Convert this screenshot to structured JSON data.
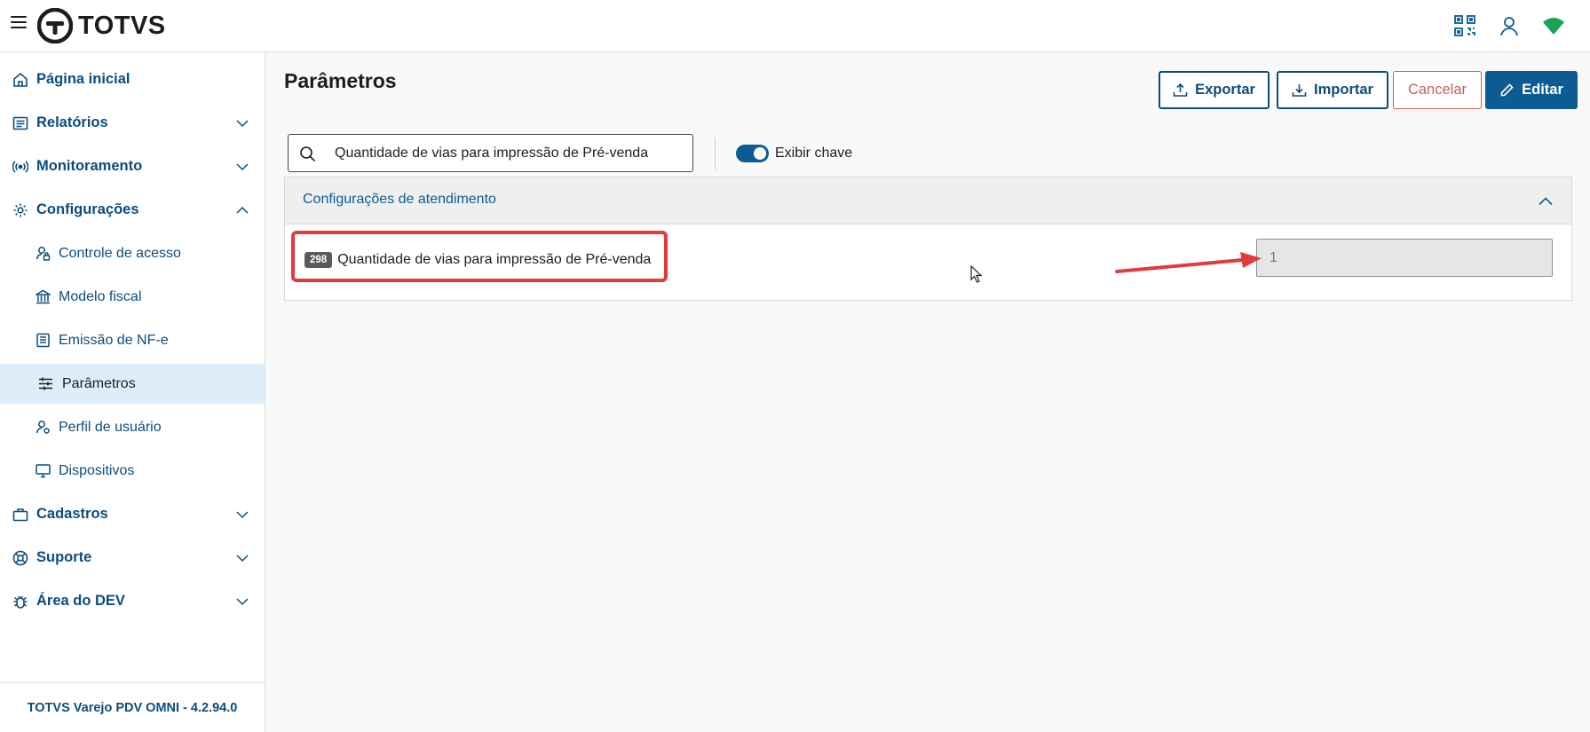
{
  "header": {
    "logo_text": "TOTVS",
    "icons": [
      "menu-icon",
      "qr-code-icon",
      "user-icon",
      "wifi-icon"
    ],
    "wifi_color": "#1ca35a"
  },
  "sidebar": {
    "items": [
      {
        "label": "Página inicial",
        "icon": "home-icon"
      },
      {
        "label": "Relatórios",
        "icon": "report-icon",
        "expanded": false
      },
      {
        "label": "Monitoramento",
        "icon": "broadcast-icon",
        "expanded": false
      },
      {
        "label": "Configurações",
        "icon": "gear-icon",
        "expanded": true
      },
      {
        "label": "Cadastros",
        "icon": "briefcase-icon",
        "expanded": false
      },
      {
        "label": "Suporte",
        "icon": "lifebuoy-icon",
        "expanded": false
      },
      {
        "label": "Área do DEV",
        "icon": "bug-icon",
        "expanded": false
      }
    ],
    "sub_items": [
      {
        "label": "Controle de acesso",
        "icon": "user-lock-icon"
      },
      {
        "label": "Modelo fiscal",
        "icon": "bank-icon"
      },
      {
        "label": "Emissão de NF-e",
        "icon": "document-icon"
      },
      {
        "label": "Parâmetros",
        "icon": "sliders-icon",
        "active": true
      },
      {
        "label": "Perfil de usuário",
        "icon": "user-settings-icon"
      },
      {
        "label": "Dispositivos",
        "icon": "monitor-icon"
      }
    ],
    "footer": "TOTVS Varejo PDV OMNI - 4.2.94.0"
  },
  "main": {
    "title": "Parâmetros",
    "buttons": {
      "export": "Exportar",
      "import": "Importar",
      "cancel": "Cancelar",
      "edit": "Editar"
    },
    "search": {
      "value": "Quantidade de vias para impressão de Pré-venda"
    },
    "toggle": {
      "label": "Exibir chave",
      "on": true
    },
    "section": {
      "title": "Configurações de atendimento",
      "expanded": true,
      "params": [
        {
          "key": "298",
          "name": "Quantidade de vias para impressão de Pré-venda",
          "value": "1"
        }
      ]
    }
  },
  "colors": {
    "primary": "#0c5c93",
    "nav_text": "#0c4d7e",
    "cancel": "#c4615d",
    "annotation": "#e03c3c",
    "active_bg": "#ddeefa"
  }
}
